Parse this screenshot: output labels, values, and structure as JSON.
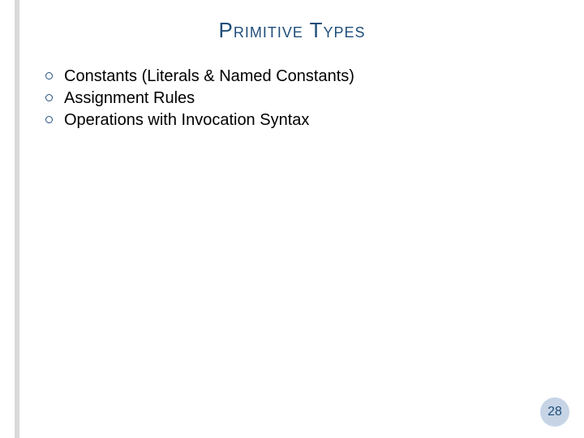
{
  "title": "Primitive Types",
  "bullets": [
    "Constants (Literals & Named Constants)",
    "Assignment Rules",
    "Operations  with Invocation Syntax"
  ],
  "page_number": "28"
}
